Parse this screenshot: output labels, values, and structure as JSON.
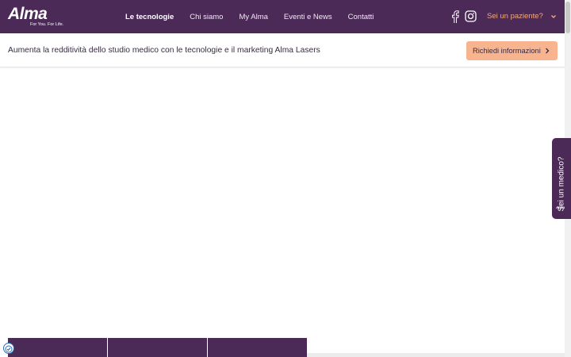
{
  "brand": {
    "logo_text": "Alma",
    "tagline": "For You. For Life."
  },
  "nav": {
    "items": [
      {
        "label": "Le tecnologie",
        "active": true
      },
      {
        "label": "Chi siamo",
        "active": false
      },
      {
        "label": "My Alma",
        "active": false
      },
      {
        "label": "Eventi e News",
        "active": false
      },
      {
        "label": "Contatti",
        "active": false
      }
    ],
    "patient_menu": "Sei un paziente?"
  },
  "social": {
    "icons": [
      "facebook-icon",
      "instagram-icon"
    ]
  },
  "subbar": {
    "text": "Aumenta la redditività dello studio medico con le tecnologie e il marketing Alma Lasers",
    "cta_label": "Richiedi informazioni"
  },
  "side_tab": {
    "label": "Sei un medico?",
    "logo_text": "Alma"
  },
  "colors": {
    "brand_purple": "#4b2a57",
    "accent_peach": "#f7b48e",
    "accent_orange_text": "#f5a97f",
    "text_dark": "#3a2a44"
  }
}
